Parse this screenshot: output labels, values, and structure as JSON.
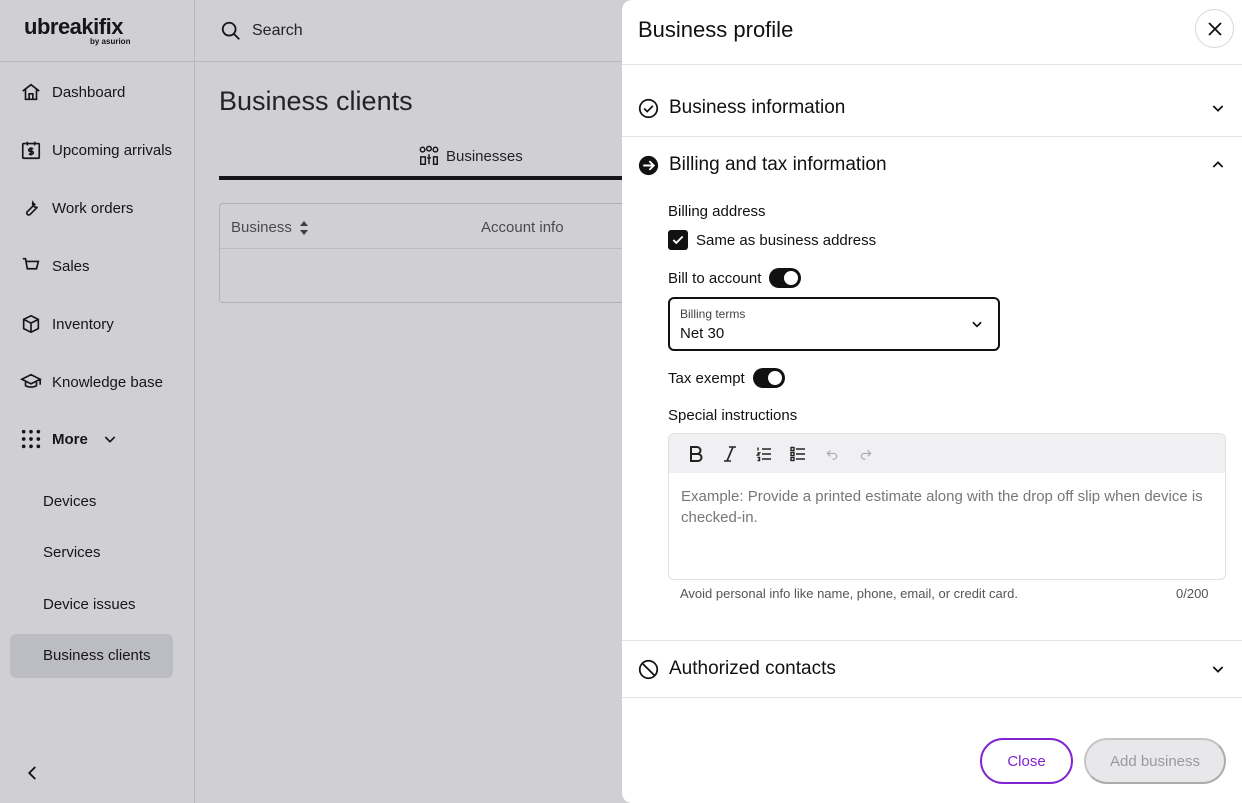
{
  "brand": {
    "name": "ubreakifix",
    "by": "by asurion"
  },
  "search": {
    "label": "Search"
  },
  "sidebar": {
    "items": [
      {
        "label": "Dashboard",
        "icon": "home-icon"
      },
      {
        "label": "Upcoming arrivals",
        "icon": "calendar-dollar-icon"
      },
      {
        "label": "Work orders",
        "icon": "wrench-icon"
      },
      {
        "label": "Sales",
        "icon": "cart-icon"
      },
      {
        "label": "Inventory",
        "icon": "box-icon"
      },
      {
        "label": "Knowledge base",
        "icon": "graduation-cap-icon"
      }
    ],
    "more_label": "More",
    "sub_items": [
      {
        "label": "Devices"
      },
      {
        "label": "Services"
      },
      {
        "label": "Device issues"
      },
      {
        "label": "Business clients",
        "active": true
      }
    ]
  },
  "main": {
    "title": "Business clients",
    "tab_label": "Businesses",
    "table": {
      "headers": [
        "Business",
        "Account info"
      ]
    }
  },
  "drawer": {
    "title": "Business profile",
    "sections": {
      "business_info": {
        "label": "Business information",
        "status_icon": "check-circle-icon"
      },
      "billing": {
        "label": "Billing and tax information",
        "status_icon": "arrow-right-circle-icon"
      },
      "contacts": {
        "label": "Authorized contacts",
        "status_icon": "blocked-circle-icon"
      }
    },
    "billing": {
      "address_label": "Billing address",
      "same_address_label": "Same as business address",
      "same_address_checked": true,
      "bill_to_account_label": "Bill to account",
      "bill_to_account_on": true,
      "terms_label": "Billing terms",
      "terms_value": "Net 30",
      "tax_exempt_label": "Tax exempt",
      "tax_exempt_on": true,
      "instructions_label": "Special instructions",
      "instructions_placeholder": "Example: Provide a printed estimate along with the drop off slip when device is checked-in.",
      "helper": "Avoid personal info like name, phone, email, or credit card.",
      "counter": "0/200"
    },
    "buttons": {
      "close": "Close",
      "add": "Add business"
    }
  },
  "colors": {
    "accent": "#8223d2",
    "disabled_bg": "#e8e8ea"
  }
}
